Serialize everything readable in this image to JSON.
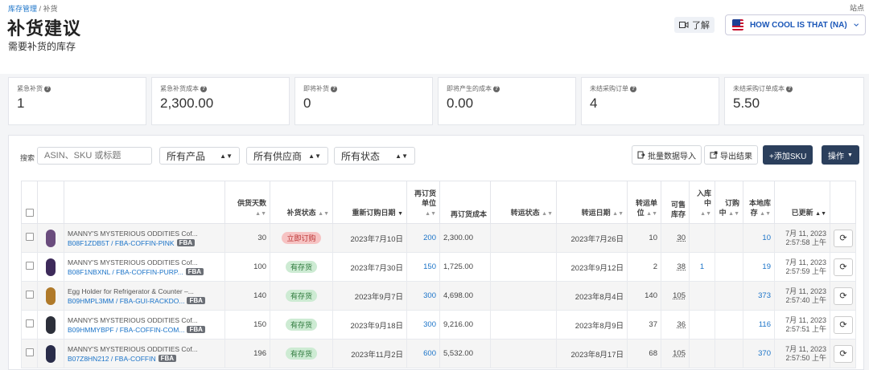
{
  "breadcrumb": {
    "root": "库存管理",
    "sep": "/",
    "current": "补货"
  },
  "corner_link": "站点",
  "title": "补货建议",
  "subtitle": "需要补货的库存",
  "learn_label": "了解",
  "store": {
    "name": "HOW COOL IS THAT (NA)",
    "flag": "us-flag-icon"
  },
  "stats": [
    {
      "label": "紧急补货",
      "value": "1"
    },
    {
      "label": "紧急补货成本",
      "value": "2,300.00"
    },
    {
      "label": "即将补货",
      "value": "0"
    },
    {
      "label": "即将产生的成本",
      "value": "0.00"
    },
    {
      "label": "未结采购订单",
      "value": "4"
    },
    {
      "label": "未结采购订单成本",
      "value": "5.50"
    }
  ],
  "filters": {
    "search_label": "搜索",
    "search_placeholder": "ASIN、SKU 或标题",
    "product": "所有产品",
    "supplier": "所有供应商",
    "status": "所有状态"
  },
  "actions": {
    "bulk_import": "批量数据导入",
    "export": "导出结果",
    "add_sku": "+添加SKU",
    "operate": "操作"
  },
  "columns": {
    "supply_days": "供货天数",
    "stock_status": "补货状态",
    "reorder_date": "重新订购日期",
    "reorder_units": "再订货单位",
    "reorder_cost": "再订货成本",
    "transfer_status": "转运状态",
    "transfer_date": "转运日期",
    "transfer_units": "转运单位",
    "sellable": "可售库存",
    "inbound": "入库中",
    "ordered": "订购中",
    "local_stock": "本地库存",
    "updated": "已更新"
  },
  "rows": [
    {
      "title": "MANNY'S MYSTERIOUS ODDITIES Cof...",
      "sku": "B08F1ZDB5T / FBA-COFFIN-PINK",
      "fba": "FBA",
      "supply_days": "30",
      "status": "立即订购",
      "status_type": "red",
      "reorder_date": "2023年7月10日",
      "units": "200",
      "cost": "2,300.00",
      "transfer_status": "",
      "transfer_date": "2023年7月26日",
      "transfer_units": "10",
      "sellable": "30",
      "inbound": "",
      "ordered": "",
      "local": "10",
      "updated_date": "7月 11, 2023",
      "updated_time": "2:57:58 上午",
      "thumb_color": "#6a4c7d"
    },
    {
      "title": "MANNY'S MYSTERIOUS ODDITIES Cof...",
      "sku": "B08F1NBXNL / FBA-COFFIN-PURP...",
      "fba": "FBA",
      "supply_days": "100",
      "status": "有存货",
      "status_type": "green",
      "reorder_date": "2023年7月30日",
      "units": "150",
      "cost": "1,725.00",
      "transfer_status": "",
      "transfer_date": "2023年9月12日",
      "transfer_units": "2",
      "sellable": "38",
      "inbound": "1",
      "ordered": "",
      "local": "19",
      "updated_date": "7月 11, 2023",
      "updated_time": "2:57:59 上午",
      "thumb_color": "#3d2a5a"
    },
    {
      "title": "Egg Holder for Refrigerator & Counter –...",
      "sku": "B09HMPL3MM / FBA-GUI-RACKDO...",
      "fba": "FBA",
      "supply_days": "140",
      "status": "有存货",
      "status_type": "green",
      "reorder_date": "2023年9月7日",
      "units": "300",
      "cost": "4,698.00",
      "transfer_status": "",
      "transfer_date": "2023年8月4日",
      "transfer_units": "140",
      "sellable": "105",
      "inbound": "",
      "ordered": "",
      "local": "373",
      "updated_date": "7月 11, 2023",
      "updated_time": "2:57:40 上午",
      "thumb_color": "#b07a2a"
    },
    {
      "title": "MANNY'S MYSTERIOUS ODDITIES Cof...",
      "sku": "B09HMMYBPF / FBA-COFFIN-COM...",
      "fba": "FBA",
      "supply_days": "150",
      "status": "有存货",
      "status_type": "green",
      "reorder_date": "2023年9月18日",
      "units": "300",
      "cost": "9,216.00",
      "transfer_status": "",
      "transfer_date": "2023年8月9日",
      "transfer_units": "37",
      "sellable": "36",
      "inbound": "",
      "ordered": "",
      "local": "116",
      "updated_date": "7月 11, 2023",
      "updated_time": "2:57:51 上午",
      "thumb_color": "#2c2f3a"
    },
    {
      "title": "MANNY'S MYSTERIOUS ODDITIES Cof...",
      "sku": "B07Z8HN212 / FBA-COFFIN",
      "fba": "FBA",
      "supply_days": "196",
      "status": "有存货",
      "status_type": "green",
      "reorder_date": "2023年11月2日",
      "units": "600",
      "cost": "5,532.00",
      "transfer_status": "",
      "transfer_date": "2023年8月17日",
      "transfer_units": "68",
      "sellable": "105",
      "inbound": "",
      "ordered": "",
      "local": "370",
      "updated_date": "7月 11, 2023",
      "updated_time": "2:57:50 上午",
      "thumb_color": "#2a2d4a"
    }
  ]
}
